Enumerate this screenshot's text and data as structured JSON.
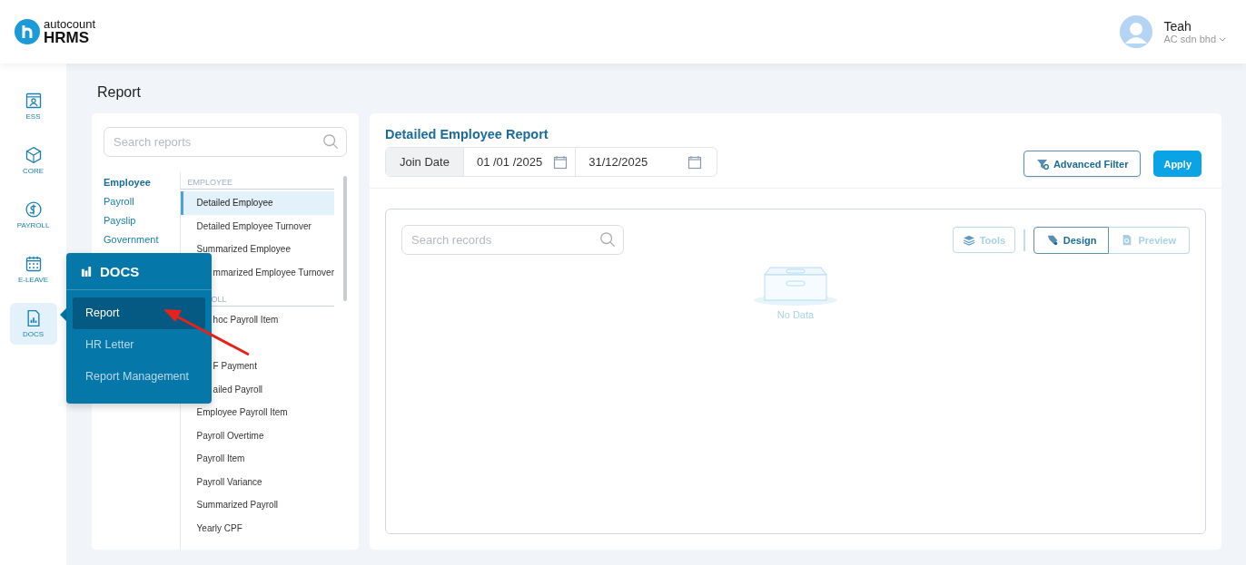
{
  "header": {
    "brand_small": "autocount",
    "brand_big": "HRMS",
    "user_name": "Teah",
    "company": "AC sdn bhd"
  },
  "rail": [
    {
      "label": "ESS",
      "selected": false
    },
    {
      "label": "CORE",
      "selected": false
    },
    {
      "label": "PAYROLL",
      "selected": false
    },
    {
      "label": "E-LEAVE",
      "selected": false
    },
    {
      "label": "DOCS",
      "selected": true
    }
  ],
  "page_title": "Report",
  "popup": {
    "title": "DOCS",
    "items": [
      {
        "label": "Report",
        "selected": true
      },
      {
        "label": "HR Letter",
        "selected": false
      },
      {
        "label": "Report Management",
        "selected": false
      }
    ]
  },
  "report_search": {
    "placeholder": "Search reports"
  },
  "categories": [
    {
      "label": "Employee",
      "selected": true
    },
    {
      "label": "Payroll",
      "selected": false
    },
    {
      "label": "Payslip",
      "selected": false
    },
    {
      "label": "Government",
      "selected": false
    }
  ],
  "reports": [
    {
      "kind": "heading",
      "label": "EMPLOYEE"
    },
    {
      "kind": "item",
      "label": "Detailed Employee",
      "selected": true
    },
    {
      "kind": "item",
      "label": "Detailed Employee Turnover",
      "selected": false
    },
    {
      "kind": "item",
      "label": "Summarized Employee",
      "selected": false
    },
    {
      "kind": "partial",
      "label": "mmarized Employee Turnover",
      "selected": false
    },
    {
      "kind": "partial_heading",
      "label": "OLL"
    },
    {
      "kind": "partial",
      "label": "hoc Payroll Item",
      "selected": false
    },
    {
      "kind": "blank"
    },
    {
      "kind": "partial",
      "label": "F Payment",
      "selected": false
    },
    {
      "kind": "partial",
      "label": "ailed Payroll",
      "selected": false
    },
    {
      "kind": "item",
      "label": "Employee Payroll Item",
      "selected": false
    },
    {
      "kind": "item",
      "label": "Payroll Overtime",
      "selected": false
    },
    {
      "kind": "item",
      "label": "Payroll Item",
      "selected": false
    },
    {
      "kind": "item",
      "label": "Payroll Variance",
      "selected": false
    },
    {
      "kind": "item",
      "label": "Summarized Payroll",
      "selected": false
    },
    {
      "kind": "item",
      "label": "Yearly CPF",
      "selected": false
    }
  ],
  "report": {
    "title": "Detailed Employee Report",
    "filter_label": "Join Date",
    "date_from": "01 /01 /2025",
    "date_to": "31/12/2025",
    "advanced_filter": "Advanced Filter",
    "apply": "Apply"
  },
  "records": {
    "search_placeholder": "Search records",
    "tools": {
      "label": "Tools",
      "disabled": true
    },
    "modes": [
      {
        "label": "Design",
        "selected": true
      },
      {
        "label": "Preview",
        "selected": false
      }
    ],
    "empty_text": "No Data"
  }
}
